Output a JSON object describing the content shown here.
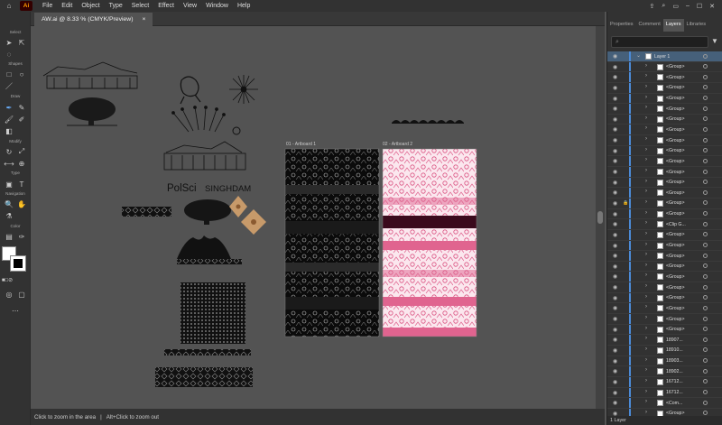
{
  "menubar": {
    "app_logo": "Ai",
    "items": [
      "File",
      "Edit",
      "Object",
      "Type",
      "Select",
      "Effect",
      "View",
      "Window",
      "Help"
    ]
  },
  "document": {
    "tab_title": "AW.ai @ 8.33 % (CMYK/Preview)",
    "close_glyph": "×"
  },
  "toolbar": {
    "sections": [
      "Select",
      "Shapes",
      "Draw",
      "Modify",
      "Type",
      "Navigation",
      "Color"
    ]
  },
  "canvas": {
    "logo_text_left": "PolSci",
    "logo_text_right": "SINGHDAM",
    "artboard1_label": "01 - Artboard 1",
    "artboard2_label": "02 - Artboard 2"
  },
  "status": {
    "left": "Click to zoom in the area",
    "right": "Alt+Click to zoom out"
  },
  "panel": {
    "tabs": [
      "Properties",
      "Comment",
      "Layers",
      "Libraries"
    ],
    "active_tab": "Layers",
    "layer_name": "Layer 1",
    "footer": "1 Layer",
    "layer_items": [
      "<Group>",
      "<Group>",
      "<Group>",
      "<Group>",
      "<Group>",
      "<Group>",
      "<Group>",
      "<Group>",
      "<Group>",
      "<Group>",
      "<Group>",
      "<Group>",
      "<Group>",
      "<Group>",
      "<Group>",
      "<Clip G...",
      "<Group>",
      "<Group>",
      "<Group>",
      "<Group>",
      "<Group>",
      "<Group>",
      "<Group>",
      "<Group>",
      "<Group>",
      "<Group>",
      "18907...",
      "18910...",
      "18903...",
      "18902...",
      "16712...",
      "16712...",
      "<Com...",
      "<Group>"
    ]
  },
  "colors": {
    "accent": "#4b8ad6",
    "artboard2_pink": "#e0648f",
    "artboard1_black": "#0a0a0a",
    "ornament_tan": "#c79a6a"
  }
}
